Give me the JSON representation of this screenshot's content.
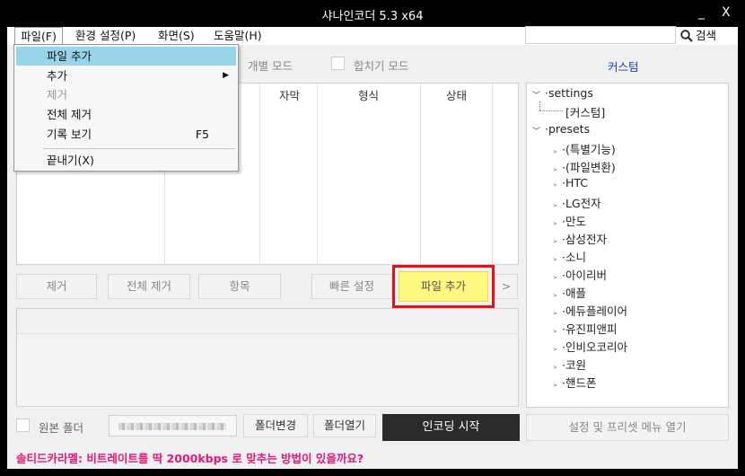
{
  "window": {
    "title": "샤나인코더  5.3  x64",
    "minimize": "_",
    "close": "X"
  },
  "menubar": {
    "items": [
      {
        "label": "파일(F)"
      },
      {
        "label": "환경 설정(P)"
      },
      {
        "label": "화면(S)"
      },
      {
        "label": "도움말(H)"
      }
    ]
  },
  "search": {
    "value": "",
    "button_label": "검색"
  },
  "modes": {
    "individual": "개별 모드",
    "merge": "합치기 모드"
  },
  "custom_link": "커스텀",
  "filelist": {
    "columns": [
      "자막",
      "형식",
      "상태"
    ]
  },
  "buttons": {
    "remove": "제거",
    "remove_all": "전체 제거",
    "item": "항목",
    "quick_setup": "빠른 설정",
    "add_file": "파일 추가",
    "more": ">"
  },
  "tree": {
    "settings": "settings",
    "custom": "[커스텀]",
    "presets": "presets",
    "children": [
      "(특별기능)",
      "(파일변환)",
      "HTC",
      "LG전자",
      "만도",
      "삼성전자",
      "소니",
      "아이리버",
      "애플",
      "에듀플레이어",
      "유진피앤피",
      "인비오코리아",
      "코원",
      "핸드폰"
    ]
  },
  "bottom": {
    "original_folder": "원본 폴더",
    "change_folder": "폴더변경",
    "open_folder": "폴더열기",
    "start_encoding": "인코딩 시작",
    "settings_menu": "설정 및 프리셋 메뉴 열기"
  },
  "status": "솔티드카라멜: 비트레이트를 딱 2000kbps 로 맞추는 방법이 있을까요?",
  "dropdown": {
    "add_file": "파일 추가",
    "add": "추가",
    "remove": "제거",
    "remove_all": "전체 제거",
    "history": "기록 보기",
    "history_shortcut": "F5",
    "exit": "끝내기(X)"
  },
  "colors": {
    "accent_link": "#1a3fc9",
    "highlight_frame": "#e0101c",
    "highlight_button": "#fff780",
    "menu_selected": "#98d4ea",
    "status_text": "#e0197a"
  }
}
